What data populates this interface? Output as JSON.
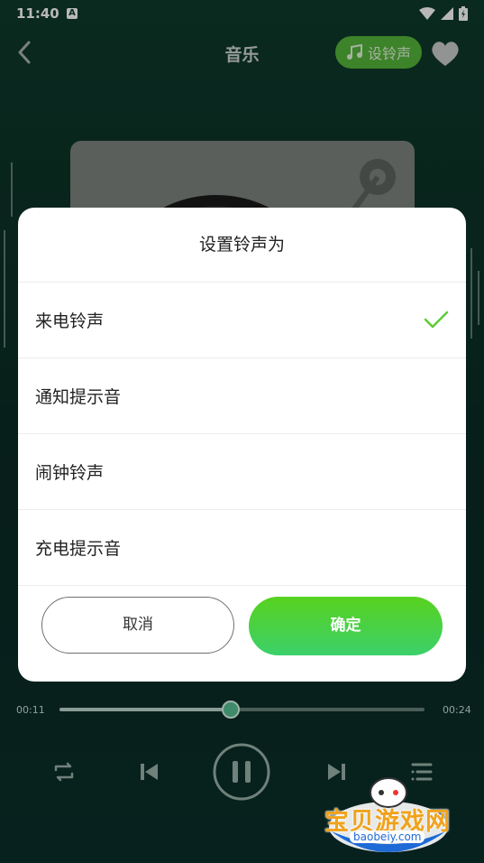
{
  "status_bar": {
    "time": "11:40",
    "notification_icon": "A"
  },
  "header": {
    "title": "音乐",
    "set_ringtone_label": "设铃声"
  },
  "dialog": {
    "title": "设置铃声为",
    "options": [
      {
        "label": "来电铃声",
        "selected": true
      },
      {
        "label": "通知提示音",
        "selected": false
      },
      {
        "label": "闹钟铃声",
        "selected": false
      },
      {
        "label": "充电提示音",
        "selected": false
      }
    ],
    "cancel_label": "取消",
    "confirm_label": "确定"
  },
  "player": {
    "current_time": "00:11",
    "total_time": "00:24",
    "progress": 0.47
  },
  "watermark": {
    "brand": "宝贝游戏网",
    "url": "baobeiy.com"
  },
  "colors": {
    "accent": "#55b63a",
    "confirm_start": "#58d21e",
    "confirm_end": "#3bd06a",
    "check": "#5dcb36"
  }
}
